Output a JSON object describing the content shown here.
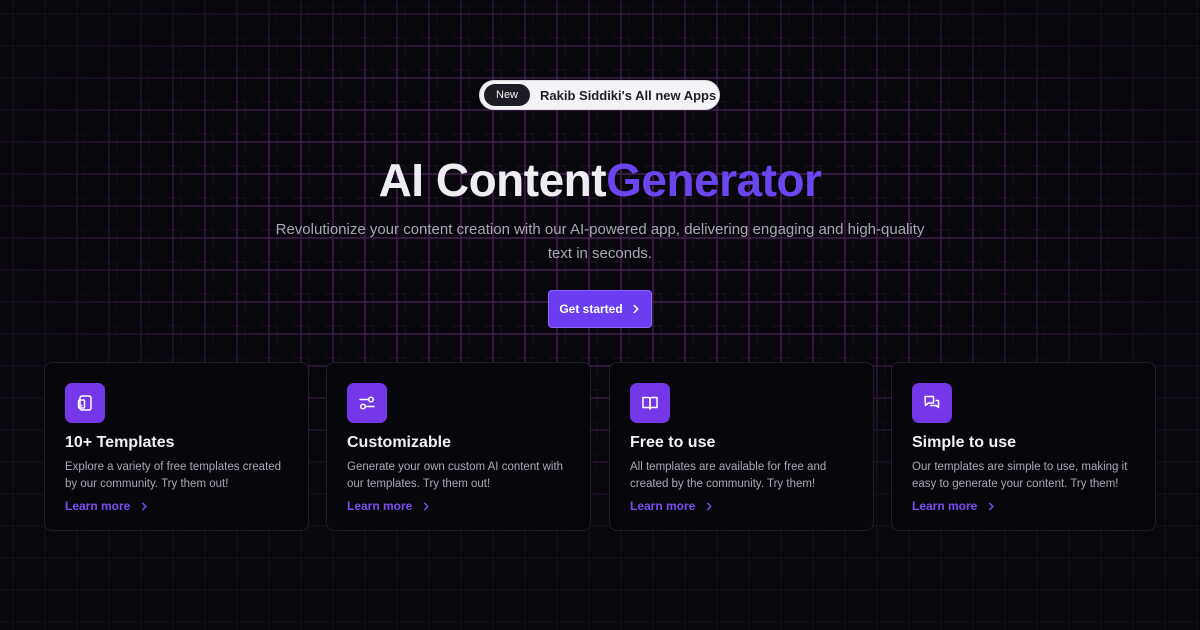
{
  "announcement": {
    "badge": "New",
    "text": "Rakib Siddiki's All new Apps",
    "icon": "chevron-right-icon"
  },
  "hero": {
    "title_part1": "AI Content",
    "title_part2": "Generator",
    "subtitle": "Revolutionize your content creation with our AI-powered app, delivering engaging and high-quality text in seconds.",
    "cta_label": "Get started"
  },
  "features": [
    {
      "icon": "tablet-icon",
      "title": "10+ Templates",
      "description": "Explore a variety of free templates created by our community. Try them out!",
      "link": "Learn more"
    },
    {
      "icon": "sliders-icon",
      "title": "Customizable",
      "description": "Generate your own custom AI content with our templates. Try them out!",
      "link": "Learn more"
    },
    {
      "icon": "book-open-icon",
      "title": "Free to use",
      "description": "All templates are available for free and created by the community. Try them!",
      "link": "Learn more"
    },
    {
      "icon": "chat-bubbles-icon",
      "title": "Simple to use",
      "description": "Our templates are simple to use, making it easy to generate your content. Try them!",
      "link": "Learn more"
    }
  ],
  "colors": {
    "background": "#07070c",
    "accent": "#6b46f0",
    "card_icon_bg": "#7438e8",
    "pattern_line": "#5b2a6e"
  }
}
